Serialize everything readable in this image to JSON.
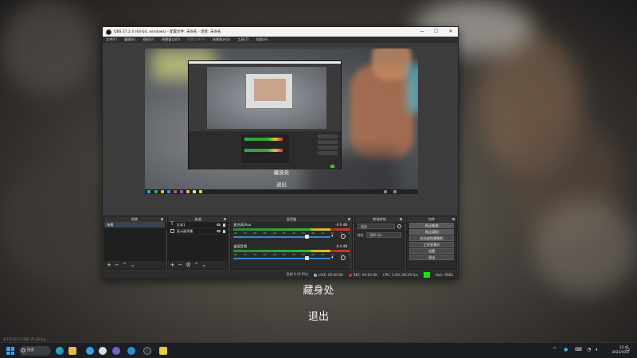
{
  "window": {
    "title": "OBS 27.2.4 (64-bit, windows) - 配置文件: 未命名 - 场景: 未命名",
    "controls": [
      "—",
      "☐",
      "✕"
    ]
  },
  "menu": [
    "文件(F)",
    "编辑(E)",
    "视图(V)",
    "停靠窗口(D)",
    "配置文件(P)",
    "场景集合(S)",
    "工具(T)",
    "帮助(H)"
  ],
  "canvas_text": {
    "line1": "藏身处",
    "line2": "退出"
  },
  "source_toolbar": {
    "label": "显示器采集",
    "properties": "属性",
    "filters": "滤镜",
    "display_label": "显示器",
    "display_value": "显示器 1: 1920x1080 @ 0,0 (主显示器)"
  },
  "scenes": {
    "header": "场景",
    "items": [
      "场景"
    ]
  },
  "sources": {
    "header": "来源",
    "items": [
      {
        "name": "文本1",
        "icon": "T"
      },
      {
        "name": "显示器采集",
        "icon": "monitor"
      }
    ]
  },
  "mixer": {
    "header": "混音器",
    "channels": [
      {
        "name": "麦克风/Aux",
        "db": "-0.9 dB",
        "ticks": [
          "-60",
          "-55",
          "-50",
          "-45",
          "-40",
          "-35",
          "-30",
          "-25",
          "-20",
          "-15",
          "-10",
          "-5",
          "0"
        ],
        "volume": 0.75
      },
      {
        "name": "桌面音频",
        "db": "-0.4 dB",
        "ticks": [
          "-60",
          "-55",
          "-50",
          "-45",
          "-40",
          "-35",
          "-30",
          "-25",
          "-20",
          "-15",
          "-10",
          "-5",
          "0"
        ],
        "volume": 0.75
      }
    ]
  },
  "transitions": {
    "header": "转场特效",
    "type": "淡出",
    "duration_label": "时长",
    "duration_value": "300 ms"
  },
  "controls": {
    "header": "控件",
    "buttons": [
      "停止推流",
      "停止录制",
      "启动虚拟摄像机",
      "工作室模式",
      "设置",
      "退出"
    ]
  },
  "status": {
    "dropped": "丢帧 0 (0.0%)",
    "live": "LIVE: 00:00:00",
    "rec": "REC: 00:03:40",
    "cpu": "CPU: 1.0%, 60.00 fps",
    "bitrate": "kb/s: 9982",
    "colors": {
      "live": "#7ab8e8",
      "rec": "#e03030",
      "ok": "#1ee01e"
    }
  },
  "overlay_text": {
    "line1": "藏身处",
    "line2": "退出"
  },
  "watermark": "4/15/12/13 [SB] 75 Sharp ...",
  "taskbar": {
    "search": "搜索",
    "time": "22:41",
    "date": "2022/10/3"
  }
}
